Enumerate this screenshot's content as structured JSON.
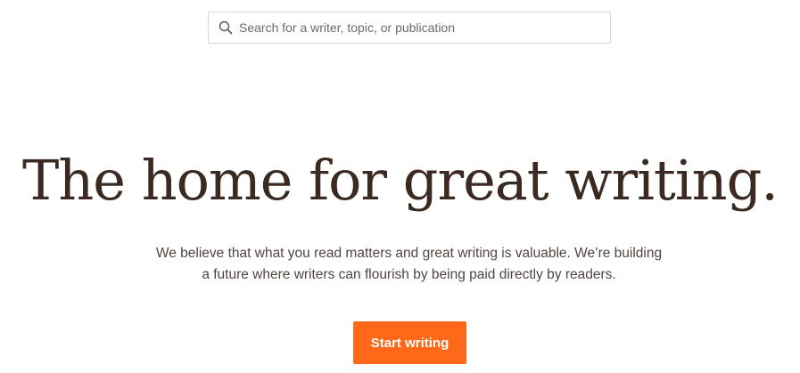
{
  "search": {
    "placeholder": "Search for a writer, topic, or publication",
    "icon": "search-icon"
  },
  "hero": {
    "title": "The home for great writing.",
    "subtitle_line1": "We believe that what you read matters and great writing is valuable. We’re building",
    "subtitle_line2": "a future where writers can flourish by being paid directly by readers."
  },
  "cta": {
    "label": "Start writing"
  },
  "colors": {
    "accent": "#ff6719",
    "title_text": "#3b2a22",
    "body_text": "#4f4541",
    "search_border": "#d9d6d2"
  }
}
